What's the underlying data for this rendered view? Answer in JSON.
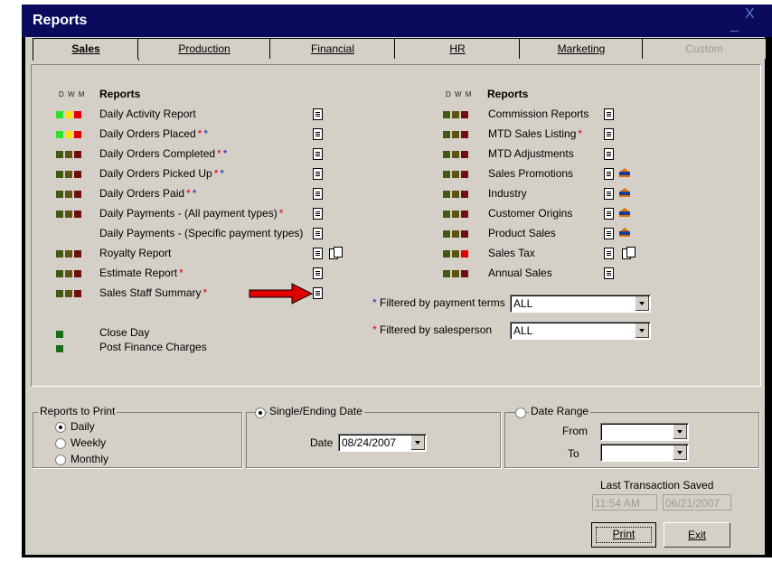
{
  "window": {
    "title": "Reports",
    "minimize": "_",
    "close": "X"
  },
  "tabs": [
    {
      "label": "Sales"
    },
    {
      "label": "Production"
    },
    {
      "label": "Financial"
    },
    {
      "label": "HR"
    },
    {
      "label": "Marketing"
    },
    {
      "label": "Custom"
    }
  ],
  "column_headers": {
    "dwm": "D W M",
    "reports": "Reports"
  },
  "left_reports": [
    {
      "label": "Daily Activity Report",
      "stars": "",
      "status": [
        "green",
        "yellow",
        "red"
      ]
    },
    {
      "label": "Daily Orders Placed",
      "stars": "rb",
      "status": [
        "green",
        "yellow",
        "red"
      ]
    },
    {
      "label": "Daily Orders Completed",
      "stars": "rb",
      "status": [
        "dkgreen",
        "dkolive",
        "dkred"
      ]
    },
    {
      "label": "Daily Orders Picked Up",
      "stars": "rb",
      "status": [
        "dkgreen",
        "dkolive",
        "dkred"
      ]
    },
    {
      "label": "Daily Orders Paid",
      "stars": "rb",
      "status": [
        "dkgreen",
        "dkolive",
        "dkred"
      ]
    },
    {
      "label": "Daily Payments - (All payment types)",
      "stars": "r",
      "status": [
        "dkgreen",
        "dkolive",
        "dkred"
      ]
    },
    {
      "label": "Daily Payments - (Specific payment types)",
      "stars": "",
      "status": []
    },
    {
      "label": "Royalty Report",
      "stars": "",
      "status": [
        "dkgreen",
        "dkolive",
        "dkred"
      ]
    },
    {
      "label": "Estimate Report",
      "stars": "r",
      "status": [
        "dkgreen",
        "dkolive",
        "dkred"
      ]
    },
    {
      "label": "Sales Staff Summary",
      "stars": "r",
      "status": [
        "dkgreen",
        "dkolive",
        "dkred"
      ]
    }
  ],
  "right_reports": [
    {
      "label": "Commission Reports",
      "stars": ""
    },
    {
      "label": "MTD Sales Listing",
      "stars": "r"
    },
    {
      "label": "MTD Adjustments",
      "stars": ""
    },
    {
      "label": "Sales Promotions",
      "stars": ""
    },
    {
      "label": "Industry",
      "stars": ""
    },
    {
      "label": "Customer Origins",
      "stars": ""
    },
    {
      "label": "Product Sales",
      "stars": ""
    },
    {
      "label": "Sales Tax",
      "stars": ""
    },
    {
      "label": "Annual Sales",
      "stars": ""
    }
  ],
  "daily_actions": [
    {
      "label": "Close Day"
    },
    {
      "label": "Post Finance Charges"
    }
  ],
  "filters": {
    "star": "*",
    "payment_terms_label": "Filtered by payment terms",
    "payment_terms_value": "ALL",
    "salesperson_label": "Filtered by salesperson",
    "salesperson_value": "ALL"
  },
  "reports_to_print": {
    "title": "Reports to Print",
    "options": [
      "Daily",
      "Weekly",
      "Monthly"
    ],
    "selected": "Daily"
  },
  "single_date": {
    "title": "Single/Ending Date",
    "date_label": "Date",
    "date_value": "08/24/2007"
  },
  "date_range": {
    "title": "Date Range",
    "from_label": "From",
    "to_label": "To",
    "from_value": "",
    "to_value": ""
  },
  "last_transaction": {
    "label": "Last Transaction Saved",
    "time": "11:54 AM",
    "date": "06/21/2007"
  },
  "buttons": {
    "print": "Print",
    "exit": "Exit"
  },
  "colors": {
    "title_bar": "#0b0b5e",
    "face": "#d4d0c8",
    "arrow": "#e00000"
  }
}
